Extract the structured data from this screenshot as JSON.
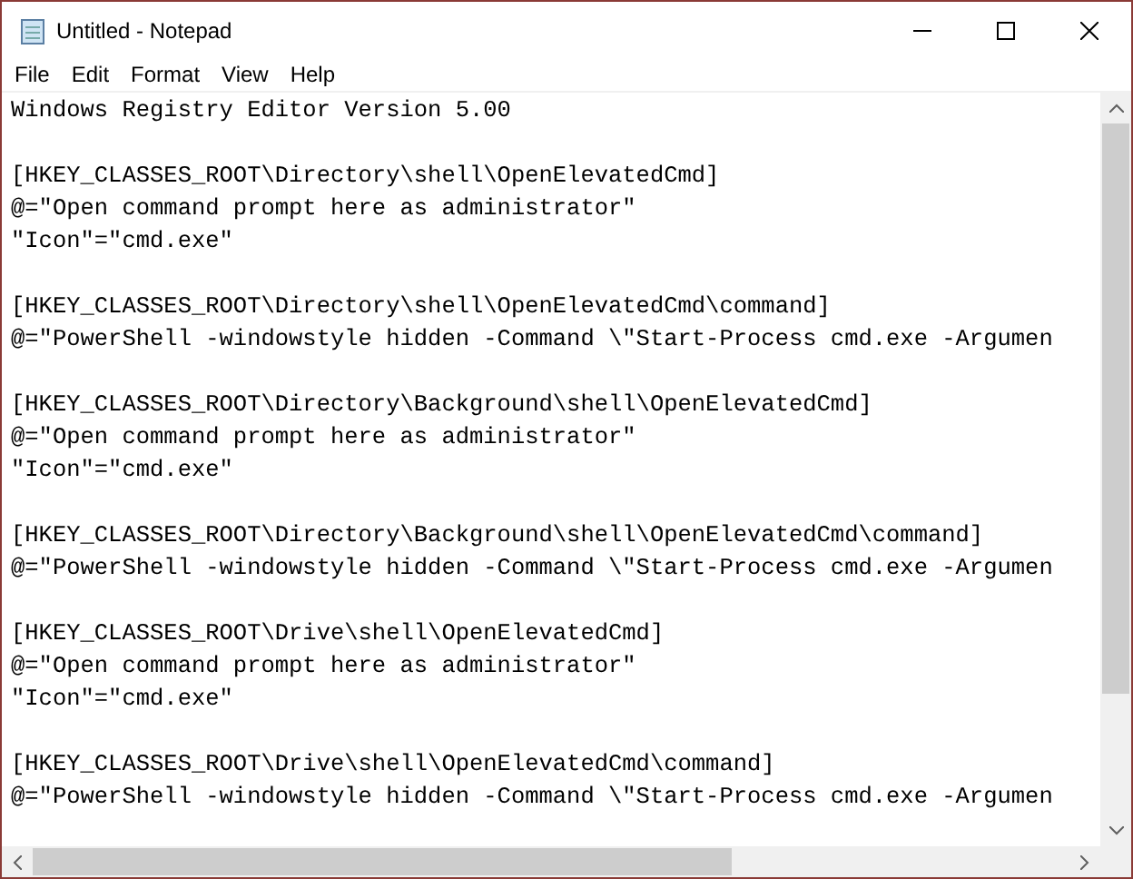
{
  "window": {
    "title": "Untitled - Notepad"
  },
  "menu": [
    "File",
    "Edit",
    "Format",
    "View",
    "Help"
  ],
  "editor": {
    "blocks": [
      [
        "Windows Registry Editor Version 5.00"
      ],
      [
        "[HKEY_CLASSES_ROOT\\Directory\\shell\\OpenElevatedCmd]",
        "@=\"Open command prompt here as administrator\"",
        "\"Icon\"=\"cmd.exe\""
      ],
      [
        "[HKEY_CLASSES_ROOT\\Directory\\shell\\OpenElevatedCmd\\command]",
        "@=\"PowerShell -windowstyle hidden -Command \\\"Start-Process cmd.exe -Argumen"
      ],
      [
        "[HKEY_CLASSES_ROOT\\Directory\\Background\\shell\\OpenElevatedCmd]",
        "@=\"Open command prompt here as administrator\"",
        "\"Icon\"=\"cmd.exe\""
      ],
      [
        "[HKEY_CLASSES_ROOT\\Directory\\Background\\shell\\OpenElevatedCmd\\command]",
        "@=\"PowerShell -windowstyle hidden -Command \\\"Start-Process cmd.exe -Argumen"
      ],
      [
        "[HKEY_CLASSES_ROOT\\Drive\\shell\\OpenElevatedCmd]",
        "@=\"Open command prompt here as administrator\"",
        "\"Icon\"=\"cmd.exe\""
      ],
      [
        "[HKEY_CLASSES_ROOT\\Drive\\shell\\OpenElevatedCmd\\command]",
        "@=\"PowerShell -windowstyle hidden -Command \\\"Start-Process cmd.exe -Argumen"
      ]
    ]
  }
}
